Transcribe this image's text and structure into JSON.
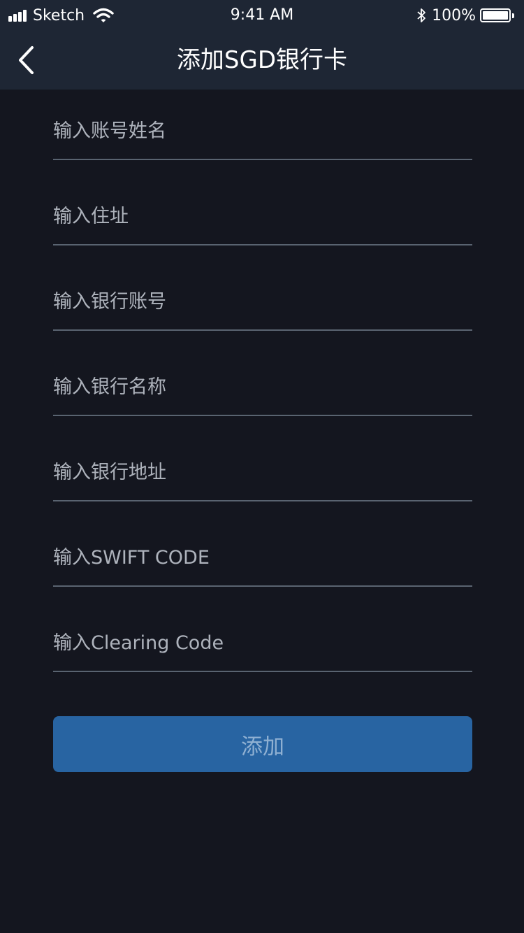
{
  "status_bar": {
    "carrier": "Sketch",
    "time": "9:41 AM",
    "battery": "100%"
  },
  "nav": {
    "title": "添加SGD银行卡"
  },
  "form": {
    "fields": [
      {
        "placeholder": "输入账号姓名",
        "value": ""
      },
      {
        "placeholder": "输入住址",
        "value": ""
      },
      {
        "placeholder": "输入银行账号",
        "value": ""
      },
      {
        "placeholder": "输入银行名称",
        "value": ""
      },
      {
        "placeholder": "输入银行地址",
        "value": ""
      },
      {
        "placeholder": "输入SWIFT CODE",
        "value": ""
      },
      {
        "placeholder": "输入Clearing Code",
        "value": ""
      }
    ],
    "submit_label": "添加"
  },
  "icons": {
    "back": "chevron-left-icon",
    "signal": "cellular-signal-icon",
    "wifi": "wifi-icon",
    "bluetooth": "bluetooth-icon",
    "battery": "battery-icon"
  },
  "colors": {
    "background": "#14161f",
    "header": "#1e2634",
    "divider": "#596370",
    "placeholder": "#aeb3bc",
    "button": "#2864a2",
    "button_text": "#8fb0d2"
  }
}
